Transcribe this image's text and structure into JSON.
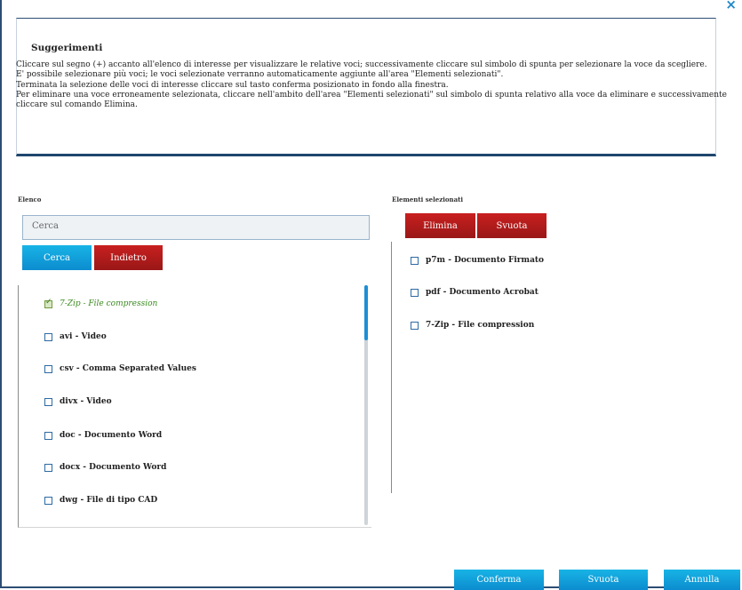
{
  "close_icon": "×",
  "tips": {
    "title": "Suggerimenti",
    "lines": [
      "Cliccare sul segno (+) accanto all'elenco di interesse per visualizzare le relative voci; successivamente cliccare sul simbolo di spunta per selezionare la voce da scegliere.",
      "E' possibile selezionare più voci; le voci selezionate verranno automaticamente aggiunte all'area \"Elementi selezionati\".",
      "Terminata la selezione delle voci di interesse cliccare sul tasto conferma posizionato in fondo alla finestra.",
      "Per eliminare una voce erroneamente selezionata, cliccare nell'ambito dell'area \"Elementi selezionati\" sul simbolo di spunta relativo alla voce da eliminare e successivamente cliccare sul comando Elimina."
    ]
  },
  "elenco": {
    "label": "Elenco",
    "search_placeholder": "Cerca",
    "cerca_button": "Cerca",
    "indietro_button": "Indietro",
    "items": [
      {
        "label": "7-Zip - File compression",
        "checked": true
      },
      {
        "label": "avi - Video",
        "checked": false
      },
      {
        "label": "csv - Comma Separated Values",
        "checked": false
      },
      {
        "label": "divx - Video",
        "checked": false
      },
      {
        "label": "doc - Documento Word",
        "checked": false
      },
      {
        "label": "docx - Documento Word",
        "checked": false
      },
      {
        "label": "dwg - File di tipo CAD",
        "checked": false
      }
    ]
  },
  "selezionati": {
    "label": "Elementi selezionati",
    "elimina_button": "Elimina",
    "svuota_button": "Svuota",
    "items": [
      {
        "label": "p7m - Documento Firmato"
      },
      {
        "label": "pdf - Documento Acrobat"
      },
      {
        "label": "7-Zip - File compression"
      }
    ]
  },
  "footer": {
    "conferma": "Conferma",
    "svuota": "Svuota",
    "annulla": "Annulla"
  }
}
